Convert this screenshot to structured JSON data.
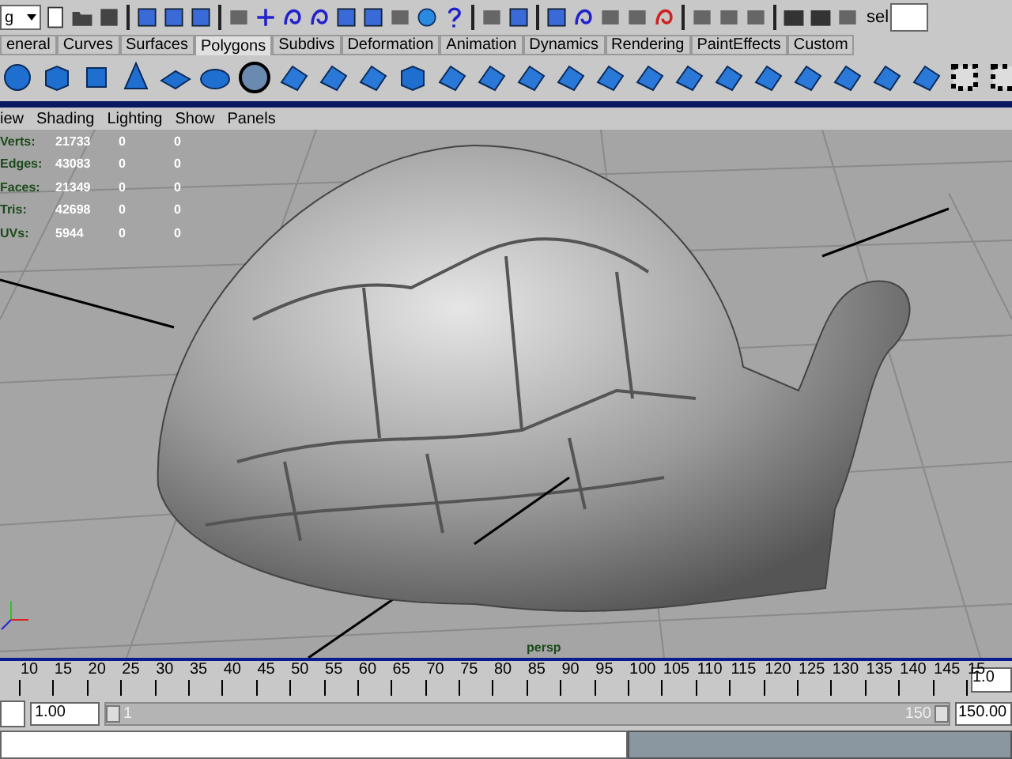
{
  "status_line": {
    "menu_set": "g",
    "selection_label": "sel"
  },
  "shelf": {
    "tabs": [
      {
        "label": "eneral",
        "selected": false
      },
      {
        "label": "Curves",
        "selected": false
      },
      {
        "label": "Surfaces",
        "selected": false
      },
      {
        "label": "Polygons",
        "selected": true
      },
      {
        "label": "Subdivs",
        "selected": false
      },
      {
        "label": "Deformation",
        "selected": false
      },
      {
        "label": "Animation",
        "selected": false
      },
      {
        "label": "Dynamics",
        "selected": false
      },
      {
        "label": "Rendering",
        "selected": false
      },
      {
        "label": "PaintEffects",
        "selected": false
      },
      {
        "label": "Custom",
        "selected": false
      }
    ]
  },
  "panel_menu": [
    "iew",
    "Shading",
    "Lighting",
    "Show",
    "Panels"
  ],
  "viewport": {
    "hud": [
      {
        "label": "Verts:",
        "values": [
          "21733",
          "0",
          "0"
        ]
      },
      {
        "label": "Edges:",
        "values": [
          "43083",
          "0",
          "0"
        ]
      },
      {
        "label": "Faces:",
        "values": [
          "21349",
          "0",
          "0"
        ]
      },
      {
        "label": "Tris:",
        "values": [
          "42698",
          "0",
          "0"
        ]
      },
      {
        "label": "UVs:",
        "values": [
          "5944",
          "0",
          "0"
        ]
      }
    ],
    "camera": "persp"
  },
  "time_slider": {
    "ticks": [
      "10",
      "15",
      "20",
      "25",
      "30",
      "35",
      "40",
      "45",
      "50",
      "55",
      "60",
      "65",
      "70",
      "75",
      "80",
      "85",
      "90",
      "95",
      "100",
      "105",
      "110",
      "115",
      "120",
      "125",
      "130",
      "135",
      "140",
      "145",
      "15"
    ],
    "current_frame": "1.0"
  },
  "range_slider": {
    "level": 1,
    "start": "1.00",
    "playback_start": "1",
    "playback_end": "150",
    "end": "150.00"
  }
}
